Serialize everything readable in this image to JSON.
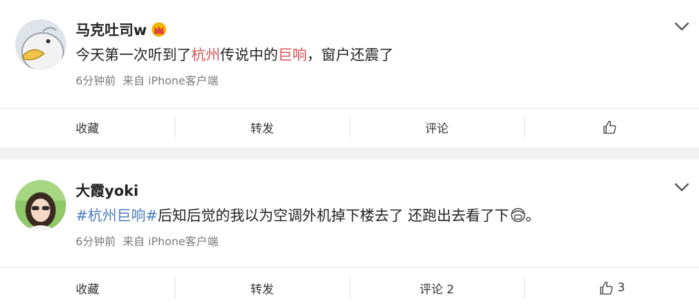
{
  "posts": [
    {
      "user": "马克吐司w",
      "text": [
        {
          "t": "今天第一次听到了",
          "c": "normal"
        },
        {
          "t": "杭州",
          "c": "hl"
        },
        {
          "t": "传说中的",
          "c": "normal"
        },
        {
          "t": "巨响",
          "c": "hl"
        },
        {
          "t": "，窗户还震了",
          "c": "normal"
        }
      ],
      "time": "6分钟前",
      "source": "来自 iPhone客户端",
      "actions": {
        "favorite": "收藏",
        "repost": "转发",
        "comment": "评论",
        "like": ""
      }
    },
    {
      "user": "大霞yoki",
      "text": [
        {
          "t": "#杭州巨响#",
          "c": "tag"
        },
        {
          "t": "后知后觉的我以为空调外机掉下楼去了 还跑出去看了下",
          "c": "normal"
        },
        {
          "t": "。",
          "c": "normal"
        }
      ],
      "time": "6分钟前",
      "source": "来自 iPhone客户端",
      "actions": {
        "favorite": "收藏",
        "repost": "转发",
        "comment": "评论 2",
        "like": "3"
      }
    }
  ],
  "colors": {
    "highlight": "#d5535a",
    "hashtag": "#4c7cbf",
    "separator": "#f2f2f2"
  },
  "icons": {
    "expand": "chevron-down-icon",
    "like": "thumbs-up-icon",
    "badge": "crown-icon",
    "emoji": "face-mask-emoji-icon"
  }
}
